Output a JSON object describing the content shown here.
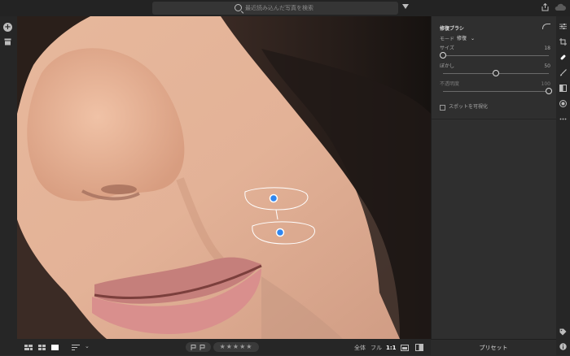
{
  "top_bar": {
    "search_placeholder": "最近読み込んだ写真を検索"
  },
  "panel": {
    "title": "修復ブラシ",
    "mode_label": "モード",
    "mode_value": "修復",
    "size": {
      "label": "サイズ",
      "value": "18",
      "level": 0.0
    },
    "feather": {
      "label": "ぼかし",
      "value": "50",
      "level": 0.5
    },
    "opacity": {
      "label": "不透明度",
      "value": "100",
      "level": 1.0
    },
    "spot_visualize_label": "スポットを可視化"
  },
  "presets_button": "プリセット",
  "bottom_bar": {
    "stars": "★★★★★",
    "zoom_fit": "全体",
    "zoom_fill": "フル",
    "zoom_1to1": "1:1"
  },
  "icons": {
    "top": [
      "search-icon",
      "filter-icon",
      "share-icon",
      "cloud-icon"
    ],
    "left": [
      "add-photo-icon",
      "library-icon"
    ],
    "right": [
      "edit-sliders-icon",
      "crop-icon",
      "healing-brush-icon",
      "brush-icon",
      "linear-gradient-icon",
      "radial-gradient-icon",
      "more-icon",
      "tag-icon",
      "info-icon"
    ]
  },
  "accent_color": "#2f86f0"
}
